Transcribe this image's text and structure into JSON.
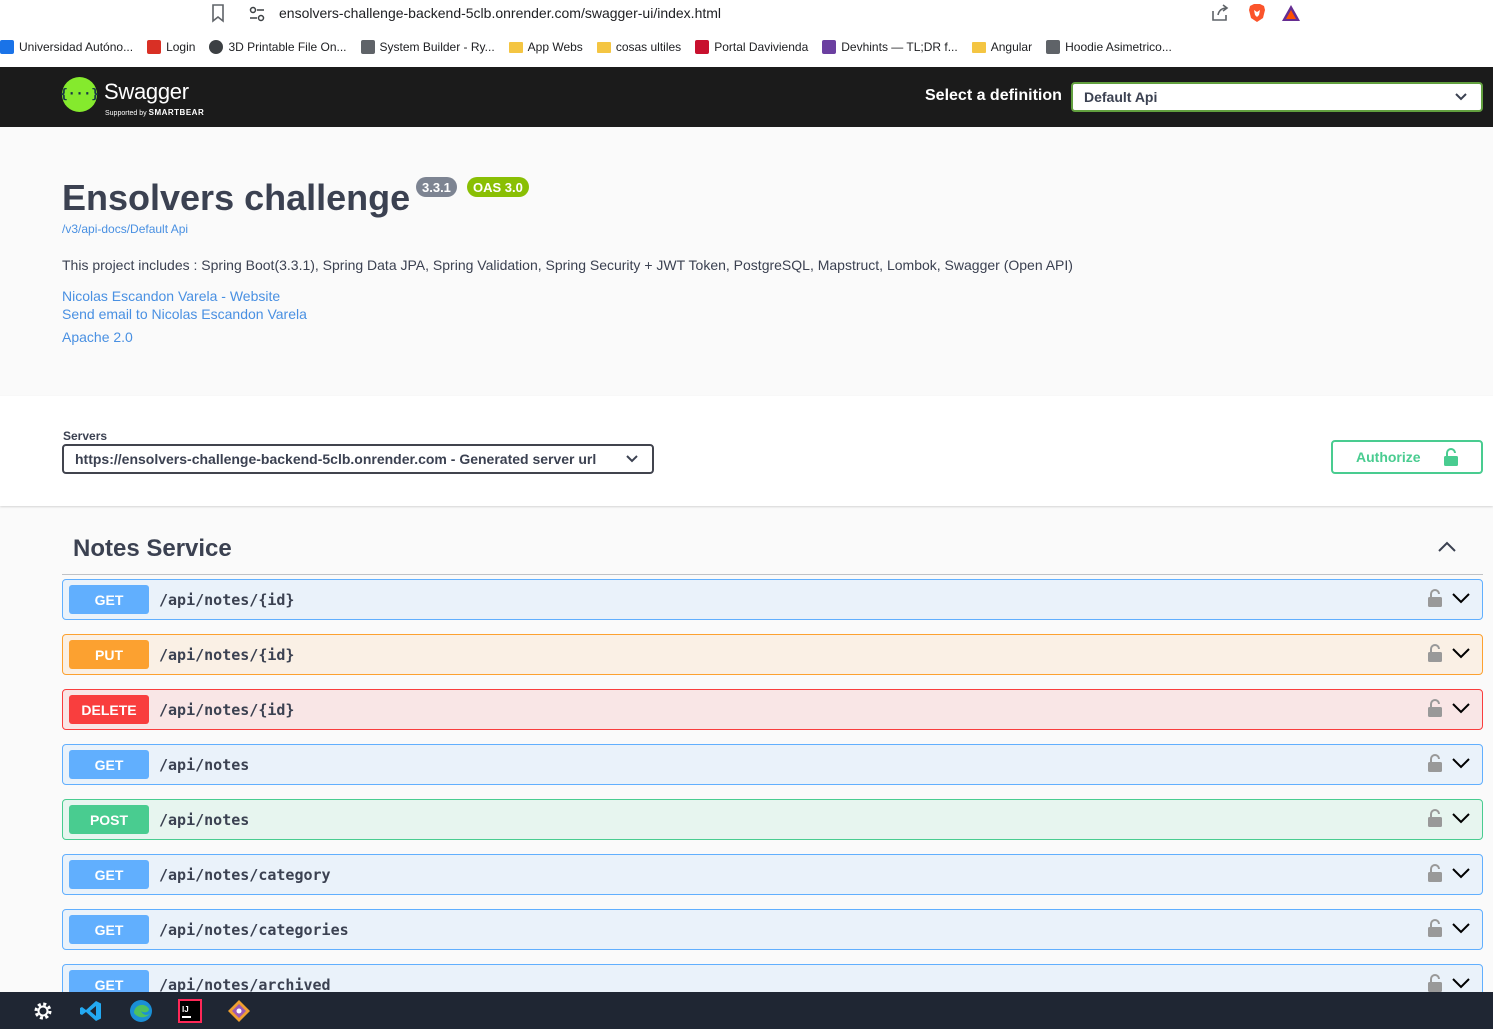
{
  "browser": {
    "url": "ensolvers-challenge-backend-5clb.onrender.com/swagger-ui/index.html",
    "bookmarks": [
      {
        "label": "Universidad Autóno...",
        "icon": "university-icon",
        "color": "#1a73e8"
      },
      {
        "label": "Login",
        "icon": "login-site-icon",
        "color": "#d93025"
      },
      {
        "label": "3D Printable File On...",
        "icon": "globe-icon",
        "color": "#3c4043"
      },
      {
        "label": "System Builder - Ry...",
        "icon": "cube-icon",
        "color": "#5f6368"
      },
      {
        "label": "App Webs",
        "icon": "folder-icon",
        "color": "#f4c542"
      },
      {
        "label": "cosas ultiles",
        "icon": "folder-icon",
        "color": "#f4c542"
      },
      {
        "label": "Portal Davivienda",
        "icon": "davivienda-icon",
        "color": "#c8102e"
      },
      {
        "label": "Devhints — TL;DR f...",
        "icon": "devhints-icon",
        "color": "#6b3fa0"
      },
      {
        "label": "Angular",
        "icon": "folder-icon",
        "color": "#f4c542"
      },
      {
        "label": "Hoodie Asimetrico...",
        "icon": "hanger-icon",
        "color": "#5f6368"
      }
    ]
  },
  "topbar": {
    "logo_text": "Swagger",
    "logo_sub_prefix": "Supported by",
    "logo_sub_brand": "SMARTBEAR",
    "definition_label": "Select a definition",
    "definition_value": "Default Api"
  },
  "info": {
    "title": "Ensolvers challenge",
    "version_badge": "3.3.1",
    "oas_badge": "OAS 3.0",
    "api_url": "/v3/api-docs/Default Api",
    "description": "This project includes : Spring Boot(3.3.1), Spring Data JPA, Spring Validation, Spring Security + JWT Token, PostgreSQL, Mapstruct, Lombok, Swagger (Open API)",
    "website_link": "Nicolas Escandon Varela - Website",
    "email_link": "Send email to Nicolas Escandon Varela",
    "license_link": "Apache 2.0"
  },
  "servers": {
    "label": "Servers",
    "selected": "https://ensolvers-challenge-backend-5clb.onrender.com - Generated server url",
    "authorize_label": "Authorize"
  },
  "tag": {
    "name": "Notes Service",
    "operations": [
      {
        "method": "GET",
        "path": "/api/notes/{id}"
      },
      {
        "method": "PUT",
        "path": "/api/notes/{id}"
      },
      {
        "method": "DELETE",
        "path": "/api/notes/{id}"
      },
      {
        "method": "GET",
        "path": "/api/notes"
      },
      {
        "method": "POST",
        "path": "/api/notes"
      },
      {
        "method": "GET",
        "path": "/api/notes/category"
      },
      {
        "method": "GET",
        "path": "/api/notes/categories"
      },
      {
        "method": "GET",
        "path": "/api/notes/archived"
      }
    ]
  },
  "colors": {
    "get": "#61affe",
    "put": "#fca130",
    "delete": "#f93e3e",
    "post": "#49cc90",
    "topbar": "#1b1b1b",
    "swagger_green": "#85ea2d"
  },
  "taskbar": {
    "items": [
      "settings-gear-icon",
      "vscode-icon",
      "edge-icon",
      "intellij-icon",
      "git-icon"
    ]
  }
}
